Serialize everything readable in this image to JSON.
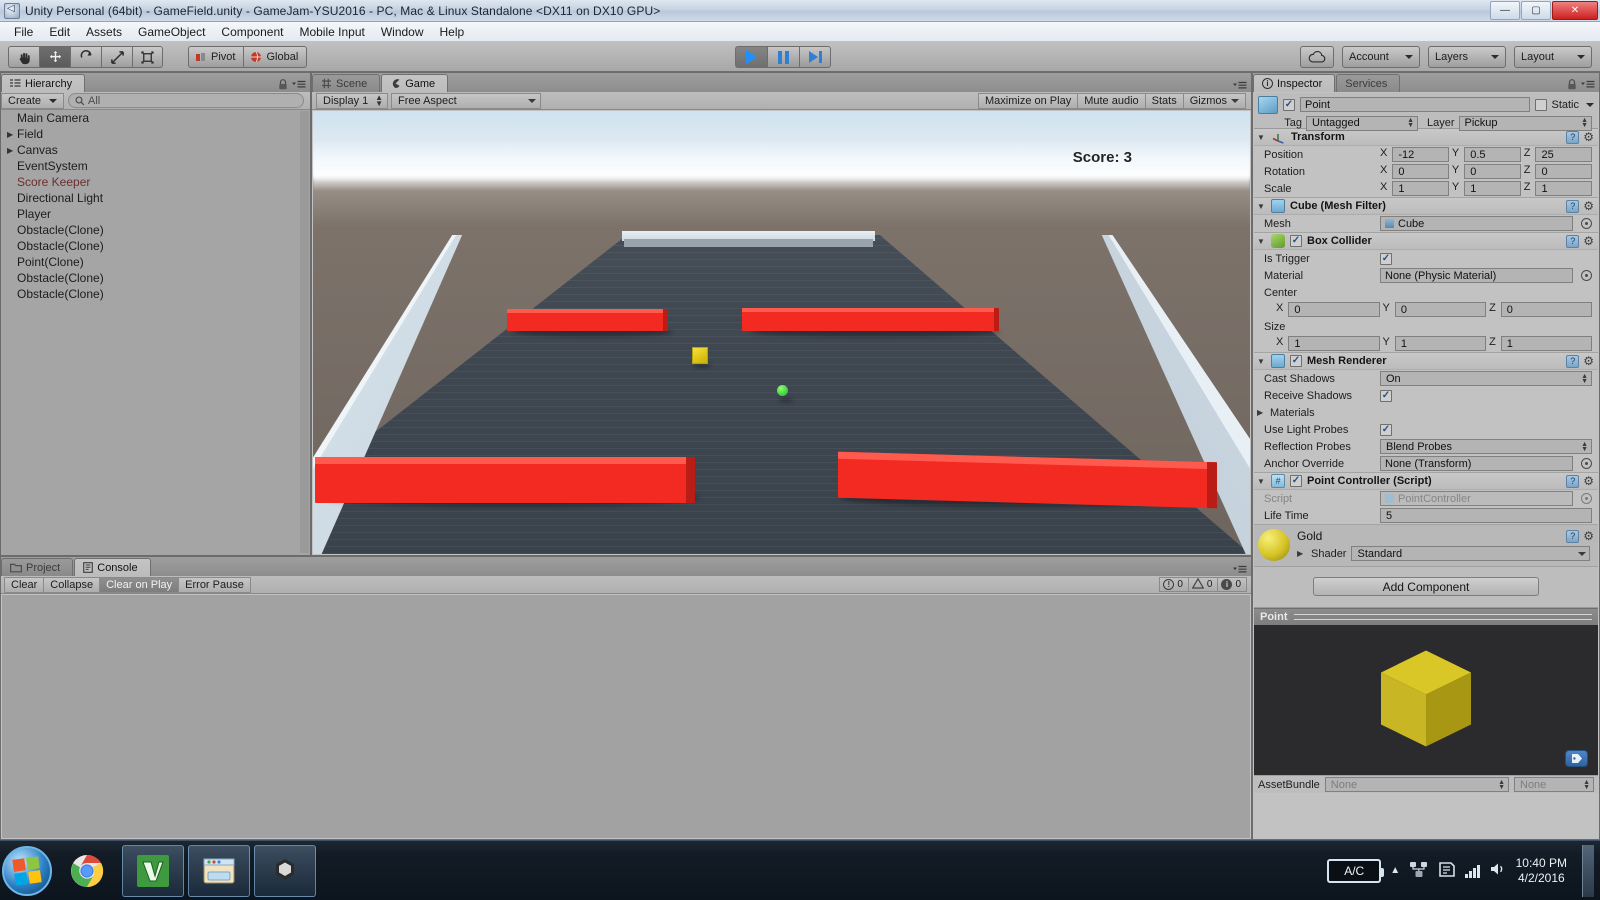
{
  "window": {
    "title": "Unity Personal (64bit) - GameField.unity - GameJam-YSU2016 - PC, Mac & Linux Standalone <DX11 on DX10 GPU>",
    "app_icon": "unity-icon",
    "minimize": "—",
    "maximize": "▢",
    "close": "✕"
  },
  "menu": {
    "items": [
      "File",
      "Edit",
      "Assets",
      "GameObject",
      "Component",
      "Mobile Input",
      "Window",
      "Help"
    ]
  },
  "toolbar": {
    "tools": [
      {
        "name": "hand-tool",
        "glyph": "✋",
        "active": false
      },
      {
        "name": "move-tool",
        "glyph": "✛",
        "active": true
      },
      {
        "name": "rotate-tool",
        "glyph": "⟳",
        "active": false
      },
      {
        "name": "scale-tool",
        "glyph": "⤢",
        "active": false
      },
      {
        "name": "rect-tool",
        "glyph": "❏",
        "active": false
      }
    ],
    "pivot_label": "Pivot",
    "global_label": "Global",
    "play_label": "play-button",
    "pause_label": "pause-button",
    "step_label": "step-button",
    "cloud_label": "cloud-icon",
    "account_label": "Account",
    "layers_label": "Layers",
    "layout_label": "Layout"
  },
  "hierarchy": {
    "tab_label": "Hierarchy",
    "create_label": "Create",
    "search_placeholder": "All",
    "search_value": "",
    "items": [
      {
        "label": "Main Camera",
        "expandable": false,
        "missing": false
      },
      {
        "label": "Field",
        "expandable": true,
        "missing": false
      },
      {
        "label": "Canvas",
        "expandable": true,
        "missing": false
      },
      {
        "label": "EventSystem",
        "expandable": false,
        "missing": false
      },
      {
        "label": "Score Keeper",
        "expandable": false,
        "missing": true
      },
      {
        "label": "Directional Light",
        "expandable": false,
        "missing": false
      },
      {
        "label": "Player",
        "expandable": false,
        "missing": false
      },
      {
        "label": "Obstacle(Clone)",
        "expandable": false,
        "missing": false
      },
      {
        "label": "Obstacle(Clone)",
        "expandable": false,
        "missing": false
      },
      {
        "label": "Point(Clone)",
        "expandable": false,
        "missing": false
      },
      {
        "label": "Obstacle(Clone)",
        "expandable": false,
        "missing": false
      },
      {
        "label": "Obstacle(Clone)",
        "expandable": false,
        "missing": false
      }
    ]
  },
  "gameview": {
    "scene_tab": "Scene",
    "game_tab": "Game",
    "display_label": "Display 1",
    "aspect_label": "Free Aspect",
    "maximize_label": "Maximize on Play",
    "mute_label": "Mute audio",
    "stats_label": "Stats",
    "gizmos_label": "Gizmos",
    "score_text": "Score: 3",
    "colors": {
      "obstacle": "#f32a22",
      "pickup": "#e6cf1f",
      "player": "#2fc93a",
      "floor": "#414955",
      "wall": "#d2dde6"
    }
  },
  "console": {
    "project_tab": "Project",
    "console_tab": "Console",
    "buttons": [
      "Clear",
      "Collapse",
      "Clear on Play",
      "Error Pause"
    ],
    "counts": {
      "errors": "0",
      "warnings": "0",
      "infos": "0"
    }
  },
  "inspector": {
    "tab_label": "Inspector",
    "services_tab": "Services",
    "object_name": "Point",
    "object_enabled": true,
    "static_label": "Static",
    "tag_label": "Tag",
    "tag_value": "Untagged",
    "layer_label": "Layer",
    "layer_value": "Pickup",
    "transform": {
      "title": "Transform",
      "rows": [
        {
          "label": "Position",
          "x": "-12",
          "y": "0.5",
          "z": "25"
        },
        {
          "label": "Rotation",
          "x": "0",
          "y": "0",
          "z": "0"
        },
        {
          "label": "Scale",
          "x": "1",
          "y": "1",
          "z": "1"
        }
      ]
    },
    "mesh_filter": {
      "title": "Cube (Mesh Filter)",
      "mesh_label": "Mesh",
      "mesh_value": "Cube"
    },
    "box_collider": {
      "title": "Box Collider",
      "enabled": true,
      "is_trigger_label": "Is Trigger",
      "is_trigger": true,
      "material_label": "Material",
      "material_value": "None (Physic Material)",
      "center_label": "Center",
      "center": {
        "x": "0",
        "y": "0",
        "z": "0"
      },
      "size_label": "Size",
      "size": {
        "x": "1",
        "y": "1",
        "z": "1"
      }
    },
    "mesh_renderer": {
      "title": "Mesh Renderer",
      "enabled": true,
      "cast_shadows_label": "Cast Shadows",
      "cast_shadows_value": "On",
      "receive_shadows_label": "Receive Shadows",
      "receive_shadows": true,
      "materials_label": "Materials",
      "light_probes_label": "Use Light Probes",
      "light_probes": true,
      "reflection_probes_label": "Reflection Probes",
      "reflection_probes_value": "Blend Probes",
      "anchor_label": "Anchor Override",
      "anchor_value": "None (Transform)"
    },
    "script_component": {
      "title": "Point Controller (Script)",
      "enabled": true,
      "script_label": "Script",
      "script_value": "PointController",
      "lifetime_label": "Life Time",
      "lifetime_value": "5"
    },
    "material": {
      "name": "Gold",
      "shader_label": "Shader",
      "shader_value": "Standard"
    },
    "add_component_label": "Add Component",
    "preview_title": "Point",
    "assetbundle_label": "AssetBundle",
    "assetbundle_value": "None",
    "assetbundle_variant": "None"
  },
  "taskbar": {
    "start_label": "start-orb",
    "tasks": [
      {
        "name": "chrome-taskbar-icon",
        "active": false
      },
      {
        "name": "vim-taskbar-icon",
        "active": true
      },
      {
        "name": "explorer-taskbar-icon",
        "active": true
      },
      {
        "name": "unity-taskbar-icon",
        "active": true
      }
    ],
    "ac_label": "A/C",
    "time": "10:40 PM",
    "date": "4/2/2016"
  }
}
